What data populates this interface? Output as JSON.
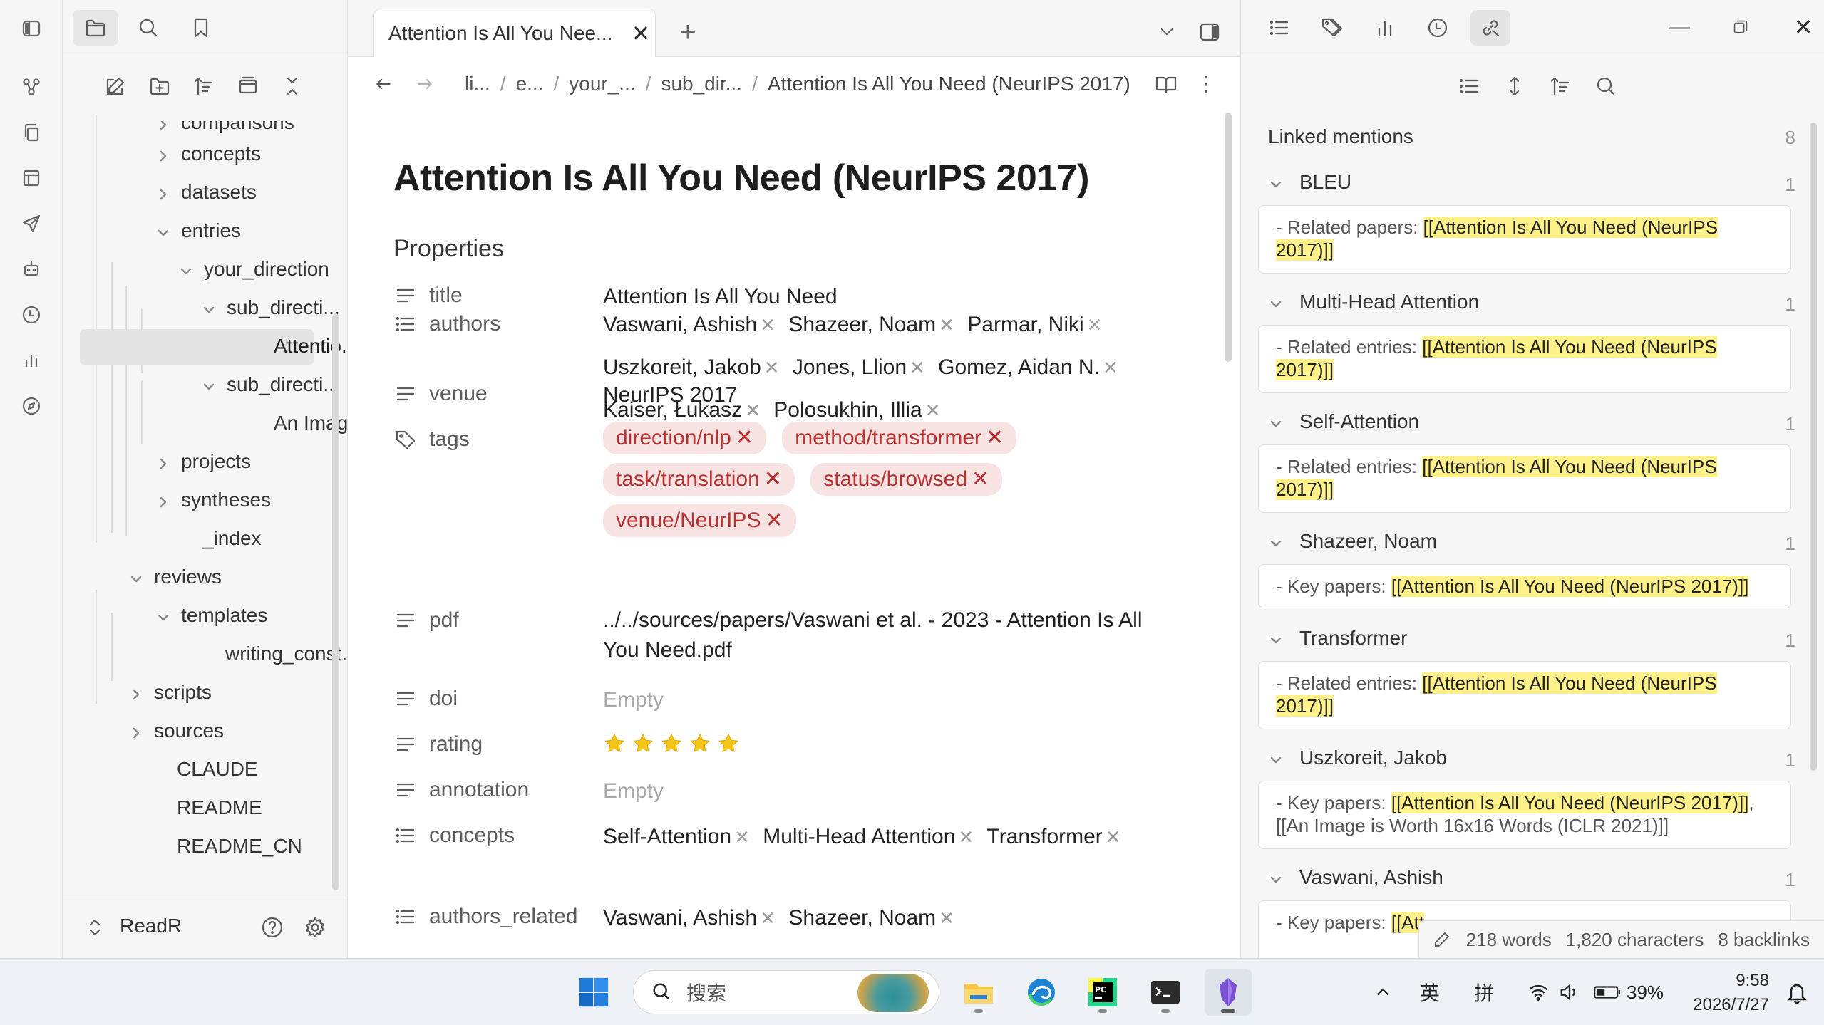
{
  "main": {
    "tab_title": "Attention Is All You Nee...",
    "breadcrumbs": [
      "li...",
      "e...",
      "your_...",
      "sub_dir...",
      "Attention Is All You Need (NeurIPS 2017)"
    ],
    "doc_title": "Attention Is All You Need (NeurIPS 2017)",
    "properties_heading": "Properties",
    "properties": {
      "title": {
        "key": "title",
        "value": "Attention Is All You Need"
      },
      "authors": {
        "key": "authors",
        "values": [
          "Vaswani, Ashish",
          "Shazeer, Noam",
          "Parmar, Niki",
          "Uszkoreit, Jakob",
          "Jones, Llion",
          "Gomez, Aidan N.",
          "Kaiser, Łukasz",
          "Polosukhin, Illia"
        ]
      },
      "venue": {
        "key": "venue",
        "value": "NeurIPS 2017"
      },
      "tags": {
        "key": "tags",
        "values": [
          "direction/nlp",
          "method/transformer",
          "task/translation",
          "status/browsed",
          "venue/NeurIPS"
        ]
      },
      "pdf": {
        "key": "pdf",
        "value": "../../sources/papers/Vaswani et al. - 2023 - Attention Is All You Need.pdf"
      },
      "doi": {
        "key": "doi",
        "value": "Empty"
      },
      "rating": {
        "key": "rating",
        "value": 5,
        "max": 5
      },
      "annotation": {
        "key": "annotation",
        "value": "Empty"
      },
      "concepts": {
        "key": "concepts",
        "values": [
          "Self-Attention",
          "Multi-Head Attention",
          "Transformer"
        ]
      },
      "authors_related": {
        "key": "authors_related",
        "values": [
          "Vaswani, Ashish",
          "Shazeer, Noam"
        ]
      }
    }
  },
  "sidebar": {
    "tree": [
      {
        "label": "comparisons",
        "type": "folder",
        "state": "collapsed"
      },
      {
        "label": "concepts",
        "type": "folder",
        "state": "collapsed"
      },
      {
        "label": "datasets",
        "type": "folder",
        "state": "collapsed"
      },
      {
        "label": "entries",
        "type": "folder",
        "state": "expanded"
      },
      {
        "label": "your_direction",
        "type": "folder",
        "state": "expanded"
      },
      {
        "label": "sub_directi...",
        "type": "folder",
        "state": "expanded"
      },
      {
        "label": "Attentio...",
        "type": "file",
        "state": "active"
      },
      {
        "label": "sub_directi...",
        "type": "folder",
        "state": "expanded"
      },
      {
        "label": "An Imag...",
        "type": "file"
      },
      {
        "label": "projects",
        "type": "folder",
        "state": "collapsed"
      },
      {
        "label": "syntheses",
        "type": "folder",
        "state": "collapsed"
      },
      {
        "label": "_index",
        "type": "file"
      },
      {
        "label": "reviews",
        "type": "folder",
        "state": "expanded"
      },
      {
        "label": "templates",
        "type": "folder",
        "state": "expanded"
      },
      {
        "label": "writing_const...",
        "type": "file"
      },
      {
        "label": "scripts",
        "type": "folder",
        "state": "collapsed"
      },
      {
        "label": "sources",
        "type": "folder",
        "state": "collapsed"
      },
      {
        "label": "CLAUDE",
        "type": "file"
      },
      {
        "label": "README",
        "type": "file"
      },
      {
        "label": "README_CN",
        "type": "file"
      }
    ],
    "vault_name": "ReadR"
  },
  "right_panel": {
    "heading": "Linked mentions",
    "total": "8",
    "groups": [
      {
        "title": "BLEU",
        "count": "1",
        "prefix": "- Related papers: ",
        "link": "[[Attention Is All You Need (NeurIPS 2017)]]",
        "suffix": ""
      },
      {
        "title": "Multi-Head Attention",
        "count": "1",
        "prefix": "- Related entries: ",
        "link": "[[Attention Is All You Need (NeurIPS 2017)]]",
        "suffix": ""
      },
      {
        "title": "Self-Attention",
        "count": "1",
        "prefix": "- Related entries: ",
        "link": "[[Attention Is All You Need (NeurIPS 2017)]]",
        "suffix": ""
      },
      {
        "title": "Shazeer, Noam",
        "count": "1",
        "prefix": "- Key papers: ",
        "link": "[[Attention Is All You Need (NeurIPS 2017)]]",
        "suffix": ""
      },
      {
        "title": "Transformer",
        "count": "1",
        "prefix": "- Related entries: ",
        "link": "[[Attention Is All You Need (NeurIPS 2017)]]",
        "suffix": ""
      },
      {
        "title": "Uszkoreit, Jakob",
        "count": "1",
        "prefix": "- Key papers: ",
        "link": "[[Attention Is All You Need (NeurIPS 2017)]]",
        "suffix": ", [[An Image is Worth 16x16 Words (ICLR 2021)]]"
      },
      {
        "title": "Vaswani, Ashish",
        "count": "1",
        "prefix": "- Key papers: ",
        "link": "[[Att",
        "suffix": ""
      }
    ]
  },
  "statusbar": {
    "words": "218 words",
    "characters": "1,820 characters",
    "backlinks": "8 backlinks"
  },
  "taskbar": {
    "search_placeholder": "搜索",
    "ime_1": "英",
    "ime_2": "拼",
    "battery": "39%",
    "time": "9:58",
    "date": "2026/7/27"
  },
  "colors": {
    "tag_bg": "#f8e3e3",
    "tag_fg": "#b83232",
    "highlight": "#fff18a",
    "star": "#f5c518"
  }
}
